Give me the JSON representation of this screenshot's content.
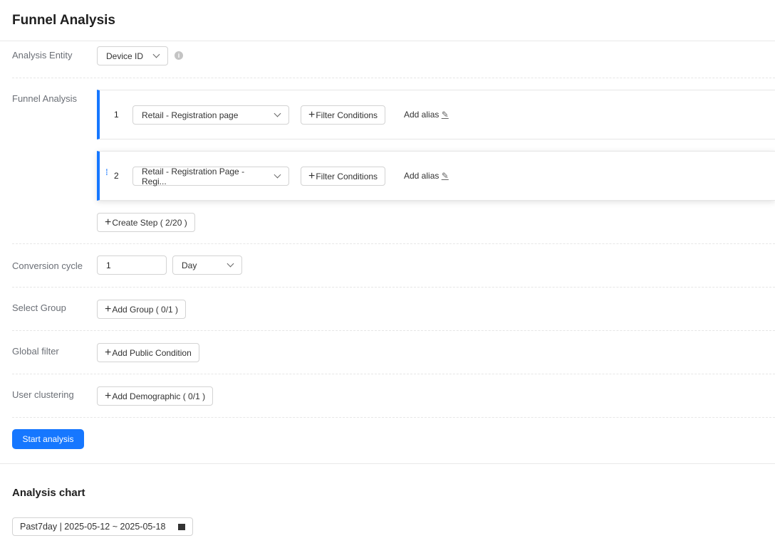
{
  "page": {
    "title": "Funnel Analysis"
  },
  "entity": {
    "label": "Analysis Entity",
    "value": "Device ID"
  },
  "funnel": {
    "label": "Funnel Analysis",
    "steps": [
      {
        "num": "1",
        "event": "Retail - Registration page",
        "filter": "Filter Conditions",
        "alias": "Add alias"
      },
      {
        "num": "2",
        "event": "Retail - Registration Page - Regi...",
        "filter": "Filter Conditions",
        "alias": "Add alias"
      }
    ],
    "create_step": "Create Step ( 2/20 )"
  },
  "conversion": {
    "label": "Conversion cycle",
    "value": "1",
    "unit": "Day"
  },
  "group": {
    "label": "Select Group",
    "button": "Add Group ( 0/1 )"
  },
  "filter": {
    "label": "Global filter",
    "button": "Add Public Condition"
  },
  "cluster": {
    "label": "User clustering",
    "button": "Add Demographic ( 0/1 )"
  },
  "start_button": "Start analysis",
  "chart": {
    "title": "Analysis chart",
    "date_range": "Past7day | 2025-05-12 ~ 2025-05-18"
  },
  "colors": {
    "accent": "#1677ff"
  }
}
